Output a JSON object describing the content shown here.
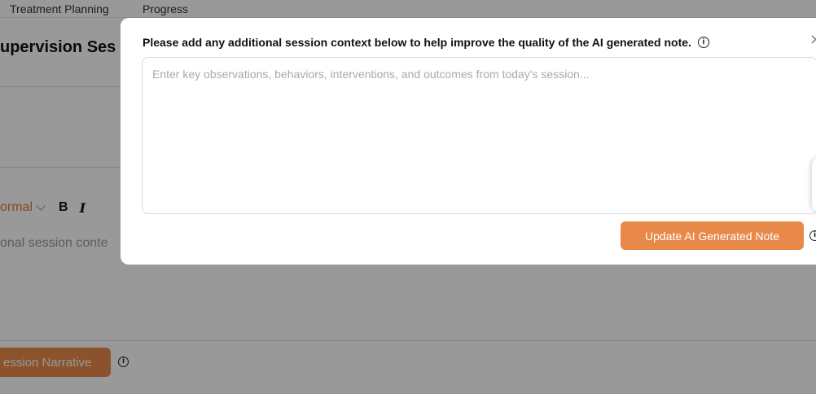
{
  "top_tabs": [
    {
      "label": "Treatment Planning"
    },
    {
      "label": "Progress"
    }
  ],
  "page": {
    "title": "upervision Ses",
    "editor": {
      "format_label": "ormal",
      "bold_label": "B",
      "italic_label": "I",
      "placeholder": "onal session conte"
    },
    "narrative_button_label": "ession Narrative"
  },
  "modal": {
    "header": "Please add any additional session context below to help improve the quality of the AI generated note.",
    "textarea": {
      "placeholder": "Enter key observations, behaviors, interventions, and outcomes from today's session...",
      "value": ""
    },
    "update_button_label": "Update AI Generated Note",
    "close_glyph": "×"
  },
  "icons": {
    "info": "info-icon",
    "close": "close-icon",
    "chevron": "chevron-down-icon"
  },
  "colors": {
    "accent": "#e8894a",
    "accent_text": "#e07b39",
    "overlay": "rgba(0,0,0,0.40)"
  }
}
